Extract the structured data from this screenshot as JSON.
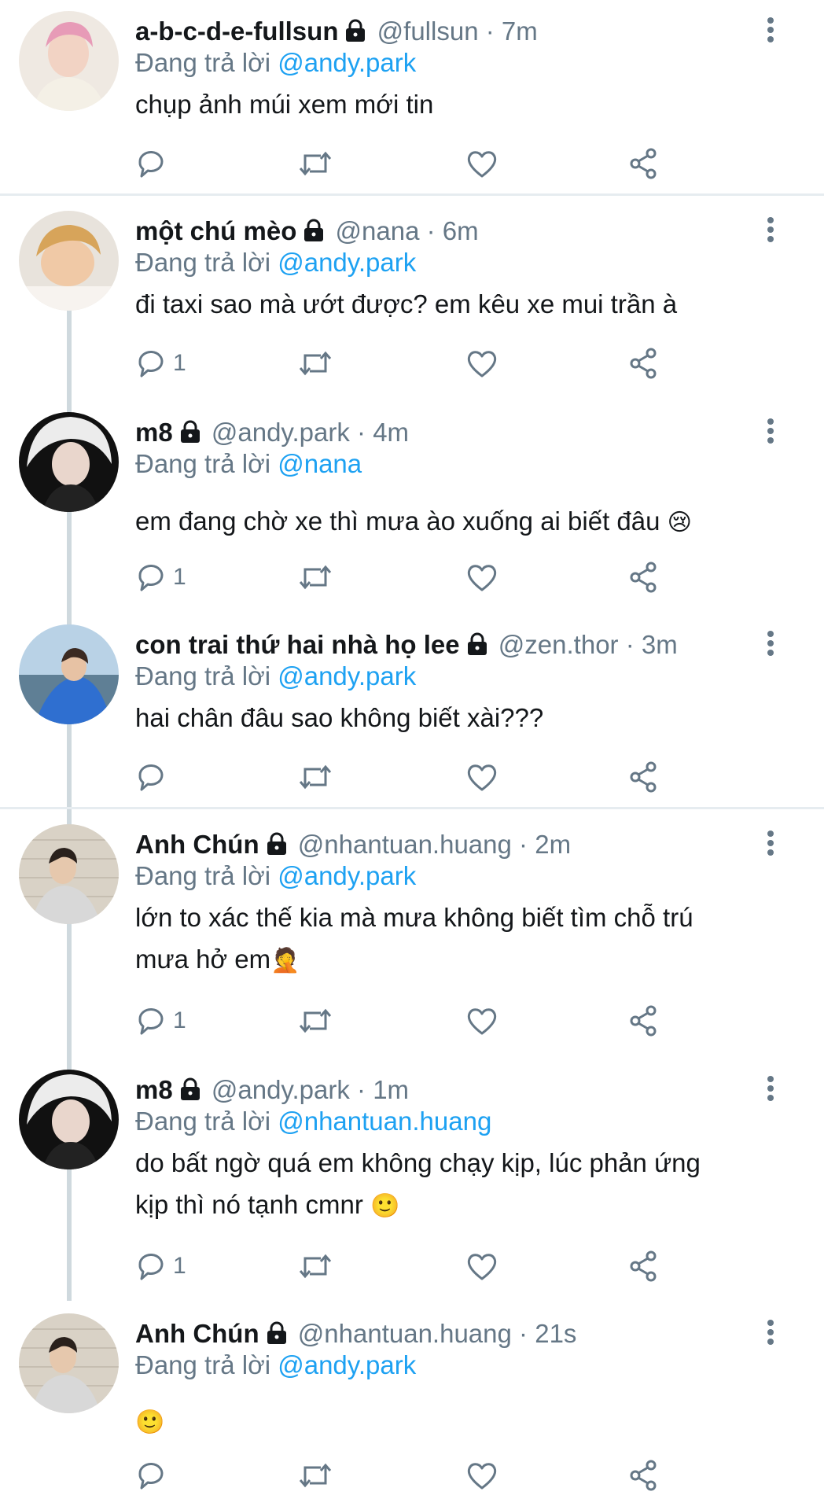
{
  "tweets": [
    {
      "name": "a-b-c-d-e-fullsun",
      "handle": "@fullsun",
      "time": "7m",
      "replying_prefix": "Đang trả lời ",
      "replying_to": "@andy.park",
      "text": "chụp ảnh múi xem mới tin",
      "reply_count": "",
      "avatar_colors": [
        "#f3d6df",
        "#d88fb0"
      ]
    },
    {
      "name": "một chú mèo",
      "handle": "@nana",
      "time": "6m",
      "replying_prefix": "Đang trả lời ",
      "replying_to": "@andy.park",
      "text": "đi taxi sao mà ướt được? em kêu xe mui trần à",
      "reply_count": "1",
      "avatar_colors": [
        "#f0c9a6",
        "#c98d5a"
      ]
    },
    {
      "name": "m8",
      "handle": "@andy.park",
      "time": "4m",
      "replying_prefix": "Đang trả lời ",
      "replying_to": "@nana",
      "text": "em đang chờ xe thì mưa ào xuống ai biết đâu",
      "text_emoji": "😢",
      "reply_count": "1",
      "avatar_colors": [
        "#e8e8e8",
        "#1c1c1c"
      ]
    },
    {
      "name": "con trai thứ hai nhà họ lee",
      "handle": "@zen.thor",
      "time": "3m",
      "replying_prefix": "Đang trả lời ",
      "replying_to": "@andy.park",
      "text": "hai chân đâu sao không biết xài???",
      "reply_count": "",
      "avatar_colors": [
        "#b9d2e6",
        "#2f6fd0"
      ]
    },
    {
      "name": "Anh Chún",
      "handle": "@nhantuan.huang",
      "time": "2m",
      "replying_prefix": "Đang trả lời ",
      "replying_to": "@andy.park",
      "text_line1": "lớn to xác thế kia mà mưa không biết tìm chỗ trú",
      "text_line2": "mưa hở em",
      "text_emoji": "🤦",
      "reply_count": "1",
      "avatar_colors": [
        "#d9d2c6",
        "#7d756b"
      ]
    },
    {
      "name": "m8",
      "handle": "@andy.park",
      "time": "1m",
      "replying_prefix": "Đang trả lời ",
      "replying_to": "@nhantuan.huang",
      "text_line1": "do bất ngờ quá em không chạy kịp, lúc phản ứng",
      "text_line2": "kịp thì nó tạnh cmnr",
      "text_emoji": "🙂",
      "reply_count": "1",
      "avatar_colors": [
        "#e8e8e8",
        "#1c1c1c"
      ]
    },
    {
      "name": "Anh Chún",
      "handle": "@nhantuan.huang",
      "time": "21s",
      "replying_prefix": "Đang trả lời ",
      "replying_to": "@andy.park",
      "text_emoji": "🙂",
      "reply_count": "",
      "avatar_colors": [
        "#d9d2c6",
        "#7d756b"
      ]
    }
  ],
  "separator_dot": "·",
  "icons": {
    "reply": "reply-icon",
    "retweet": "retweet-icon",
    "like": "like-icon",
    "share": "share-icon",
    "more": "more-icon",
    "lock": "lock-icon"
  },
  "colors": {
    "name": "#14171a",
    "secondary": "#657786",
    "mention": "#1da1f2",
    "thread_line": "#cfd9de",
    "divider": "#e6ecf0"
  }
}
